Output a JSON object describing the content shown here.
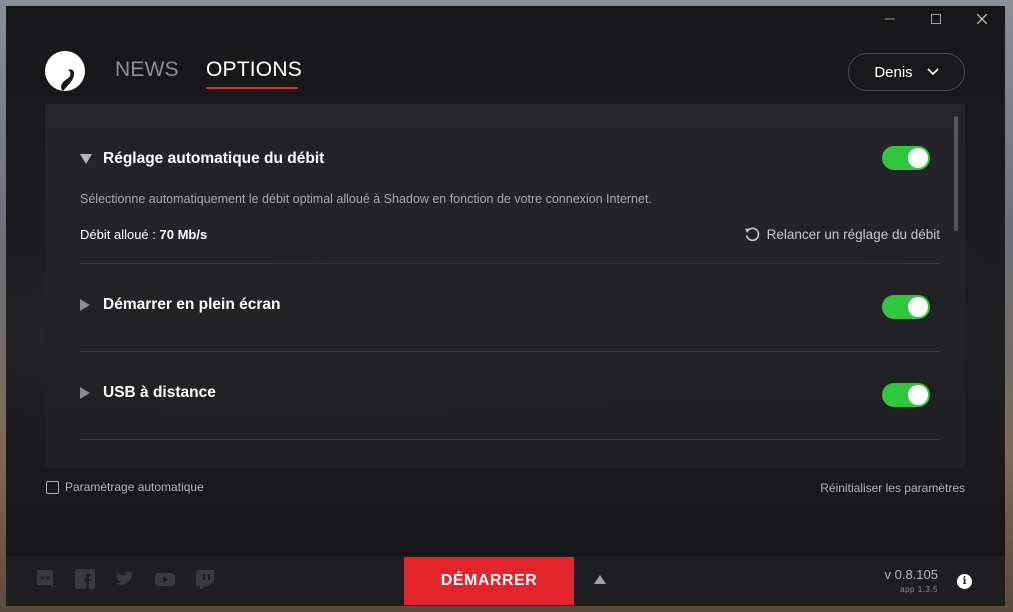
{
  "window": {
    "minimize": "—",
    "maximize": "☐",
    "close": "✕"
  },
  "nav": {
    "news": "NEWS",
    "options": "OPTIONS"
  },
  "user": {
    "name": "Denis"
  },
  "settings": {
    "items": [
      {
        "title": "Réglage automatique du débit",
        "expanded": true,
        "enabled": true,
        "description": "Sélectionne automatiquement le débit optimal alloué à Shadow en fonction de votre connexion Internet.",
        "debit_label": "Débit alloué : ",
        "debit_value": "70 Mb/s",
        "relaunch": "Relancer un réglage du débit"
      },
      {
        "title": "Démarrer en plein écran",
        "expanded": false,
        "enabled": true
      },
      {
        "title": "USB à distance",
        "expanded": false,
        "enabled": true
      }
    ]
  },
  "footer": {
    "auto_config": "Paramètrage automatique",
    "auto_config_checked": false,
    "reset": "Réinitialiser les paramètres"
  },
  "bottom": {
    "social": [
      "discord-icon",
      "facebook-icon",
      "twitter-icon",
      "youtube-icon",
      "twitch-icon"
    ],
    "start": "DÉMARRER",
    "version": "v 0.8.105",
    "app_version": "app 1.3.5"
  },
  "colors": {
    "accent": "#e2242b",
    "toggle_on": "#2fc73c"
  }
}
